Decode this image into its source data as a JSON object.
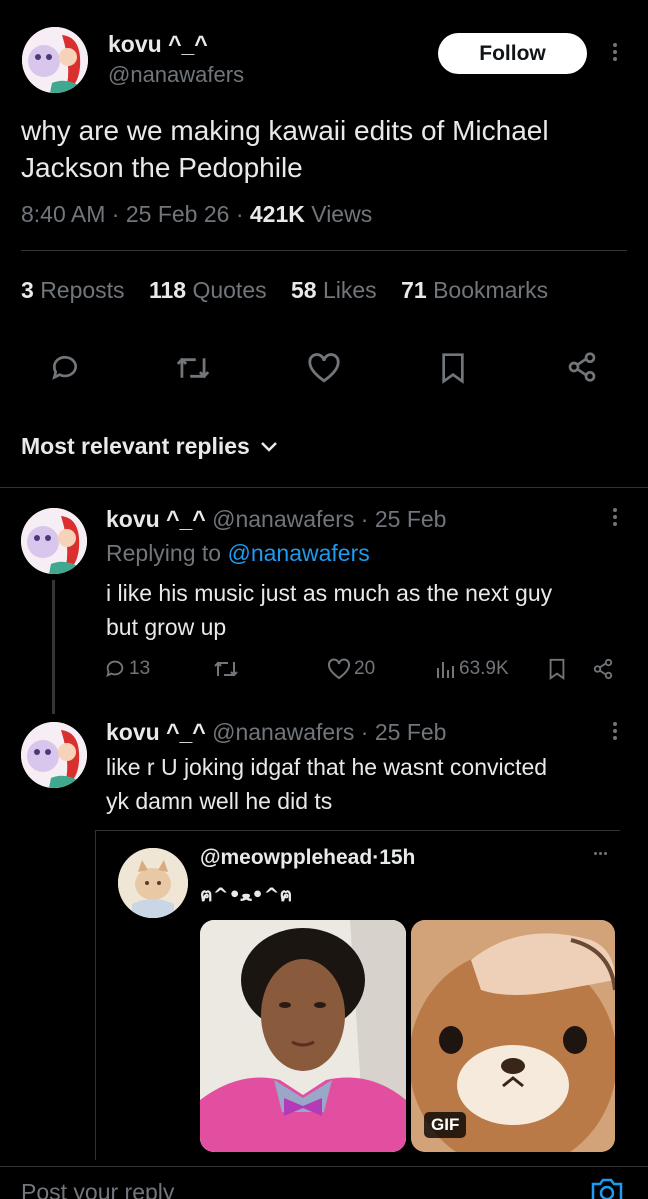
{
  "post": {
    "author_name": "kovu ^_^",
    "author_handle": "@nanawafers",
    "follow_label": "Follow",
    "text_line1": "why are we making kawaii edits of Michael",
    "text_line2": "Jackson the Pedophile",
    "time": "8:40 AM",
    "date": "25 Feb 26",
    "views_count": "421K",
    "views_label": "Views",
    "stats": {
      "reposts_count": "3",
      "reposts_label": "Reposts",
      "quotes_count": "118",
      "quotes_label": "Quotes",
      "likes_count": "58",
      "likes_label": "Likes",
      "bookmarks_count": "71",
      "bookmarks_label": "Bookmarks"
    },
    "actions": [
      "reply-icon",
      "repost-icon",
      "like-icon",
      "bookmark-icon",
      "share-icon"
    ]
  },
  "sort": {
    "label": "Most relevant replies"
  },
  "reply1": {
    "author_name": "kovu ^_^",
    "author_handle": "@nanawafers",
    "date": "25 Feb",
    "replying_prefix": "Replying to",
    "replying_handle": "@nanawafers",
    "text_line1": "i like his music just as much as the next guy",
    "text_line2": "but grow up",
    "replies": "13",
    "likes": "20",
    "views": "63.9K"
  },
  "reply2": {
    "author_name": "kovu ^_^",
    "author_handle": "@nanawafers",
    "date": "25 Feb",
    "text_line1": "like r U joking  idgaf that he wasnt convicted",
    "text_line2": "yk damn well he did ts"
  },
  "quote": {
    "author_handle": "@meowpplehead",
    "age": "15h",
    "text": "ฅ^•ﻌ•^ฅ",
    "gif_badge": "GIF"
  },
  "compose": {
    "placeholder": "Post your reply"
  },
  "colors": {
    "background": "#000000",
    "link": "#1d9bf0",
    "muted": "#71767b",
    "divider": "#2f3336"
  }
}
